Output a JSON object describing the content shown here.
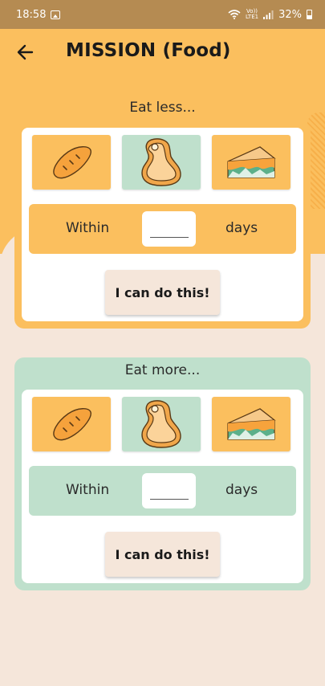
{
  "status_bar": {
    "time": "18:58",
    "network": "Vo))\nLTE1",
    "battery": "32%"
  },
  "header": {
    "title": "MISSION (Food)"
  },
  "missions": [
    {
      "heading": "Eat less...",
      "foods": [
        "bread-icon",
        "meat-icon",
        "cheese-icon"
      ],
      "within_label": "Within",
      "days_value": "",
      "days_label": "days",
      "button_label": "I can do this!"
    },
    {
      "heading": "Eat more...",
      "foods": [
        "bread-icon",
        "meat-icon",
        "cheese-icon"
      ],
      "within_label": "Within",
      "days_value": "",
      "days_label": "days",
      "button_label": "I can do this!"
    }
  ],
  "colors": {
    "accent": "#fbbf5e",
    "mint": "#bfe0cc",
    "background": "#f5e6da",
    "status_bar": "#b58b52"
  }
}
